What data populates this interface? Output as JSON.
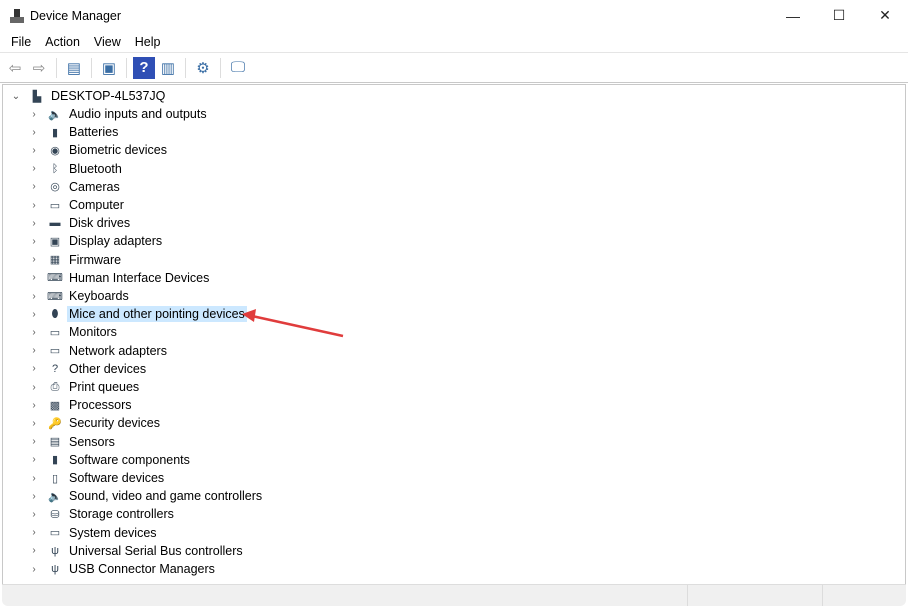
{
  "window": {
    "title": "Device Manager",
    "minimize": "—",
    "maximize": "☐",
    "close": "✕"
  },
  "menu": [
    "File",
    "Action",
    "View",
    "Help"
  ],
  "toolbar": [
    {
      "icon": "back-icon",
      "glyph": "⇦"
    },
    {
      "icon": "forward-icon",
      "glyph": "⇨"
    },
    {
      "icon": "show-hide-console-tree-icon",
      "glyph": "▤"
    },
    {
      "icon": "properties-icon",
      "glyph": "▣"
    },
    {
      "icon": "help-icon",
      "glyph": "?"
    },
    {
      "icon": "run-icon",
      "glyph": "▥"
    },
    {
      "icon": "update-driver-icon",
      "glyph": "⚙"
    },
    {
      "icon": "scan-hardware-icon",
      "glyph": "🖵"
    }
  ],
  "tree": {
    "root": "DESKTOP-4L537JQ",
    "selected_index": 11,
    "items": [
      {
        "label": "Audio inputs and outputs",
        "glyph": "🔈"
      },
      {
        "label": "Batteries",
        "glyph": "▮"
      },
      {
        "label": "Biometric devices",
        "glyph": "◉"
      },
      {
        "label": "Bluetooth",
        "glyph": "ᛒ"
      },
      {
        "label": "Cameras",
        "glyph": "◎"
      },
      {
        "label": "Computer",
        "glyph": "▭"
      },
      {
        "label": "Disk drives",
        "glyph": "▬"
      },
      {
        "label": "Display adapters",
        "glyph": "▣"
      },
      {
        "label": "Firmware",
        "glyph": "▦"
      },
      {
        "label": "Human Interface Devices",
        "glyph": "⌨"
      },
      {
        "label": "Keyboards",
        "glyph": "⌨"
      },
      {
        "label": "Mice and other pointing devices",
        "glyph": "⬮"
      },
      {
        "label": "Monitors",
        "glyph": "▭"
      },
      {
        "label": "Network adapters",
        "glyph": "▭"
      },
      {
        "label": "Other devices",
        "glyph": "?"
      },
      {
        "label": "Print queues",
        "glyph": "⎙"
      },
      {
        "label": "Processors",
        "glyph": "▩"
      },
      {
        "label": "Security devices",
        "glyph": "🔑"
      },
      {
        "label": "Sensors",
        "glyph": "▤"
      },
      {
        "label": "Software components",
        "glyph": "▮"
      },
      {
        "label": "Software devices",
        "glyph": "▯"
      },
      {
        "label": "Sound, video and game controllers",
        "glyph": "🔈"
      },
      {
        "label": "Storage controllers",
        "glyph": "⛁"
      },
      {
        "label": "System devices",
        "glyph": "▭"
      },
      {
        "label": "Universal Serial Bus controllers",
        "glyph": "ψ"
      },
      {
        "label": "USB Connector Managers",
        "glyph": "ψ"
      }
    ]
  },
  "colors": {
    "selection": "#cce8ff",
    "arrow": "#e03c3c"
  }
}
